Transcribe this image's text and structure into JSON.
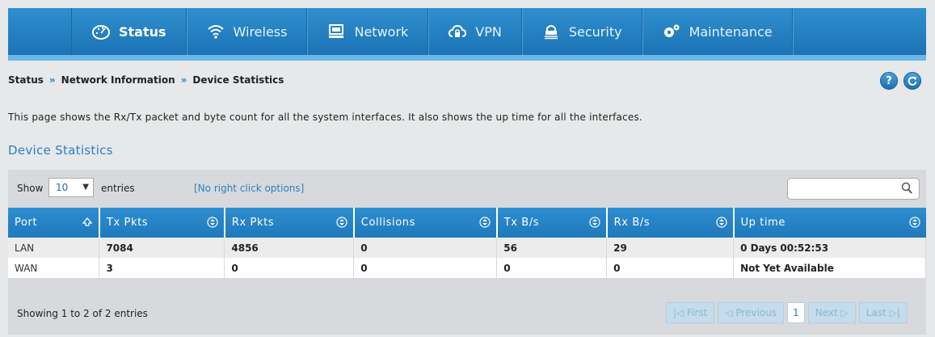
{
  "nav": {
    "items": [
      {
        "label": "Status",
        "icon": "dashboard-icon",
        "active": true
      },
      {
        "label": "Wireless",
        "icon": "wifi-icon",
        "active": false
      },
      {
        "label": "Network",
        "icon": "monitor-icon",
        "active": false
      },
      {
        "label": "VPN",
        "icon": "cloud-lock-icon",
        "active": false
      },
      {
        "label": "Security",
        "icon": "lock-icon",
        "active": false
      },
      {
        "label": "Maintenance",
        "icon": "gears-icon",
        "active": false
      }
    ]
  },
  "breadcrumb": {
    "items": [
      "Status",
      "Network Information",
      "Device Statistics"
    ],
    "separator": "»"
  },
  "header_buttons": {
    "help": "?",
    "refresh_icon": "refresh-icon"
  },
  "description": "This page shows the Rx/Tx packet and byte count for all the system interfaces. It also shows the up time for all the interfaces.",
  "section_title": "Device Statistics",
  "table_controls": {
    "show_label": "Show",
    "page_length": "10",
    "entries_label": "entries",
    "right_click_note": "[No right click options]",
    "search_placeholder": ""
  },
  "table": {
    "columns": [
      "Port",
      "Tx Pkts",
      "Rx Pkts",
      "Collisions",
      "Tx B/s",
      "Rx B/s",
      "Up time"
    ],
    "rows": [
      [
        "LAN",
        "7084",
        "4856",
        "0",
        "56",
        "29",
        "0 Days 00:52:53"
      ],
      [
        "WAN",
        "3",
        "0",
        "0",
        "0",
        "0",
        "Not Yet Available"
      ]
    ]
  },
  "footer": {
    "info": "Showing 1 to 2 of 2 entries",
    "pager": {
      "first": "First",
      "previous": "Previous",
      "current": "1",
      "next": "Next",
      "last": "Last"
    }
  },
  "colors": {
    "accent": "#2a7fc2",
    "nav_bg": "#1f79bb",
    "page_bg": "#e7e8e9"
  }
}
